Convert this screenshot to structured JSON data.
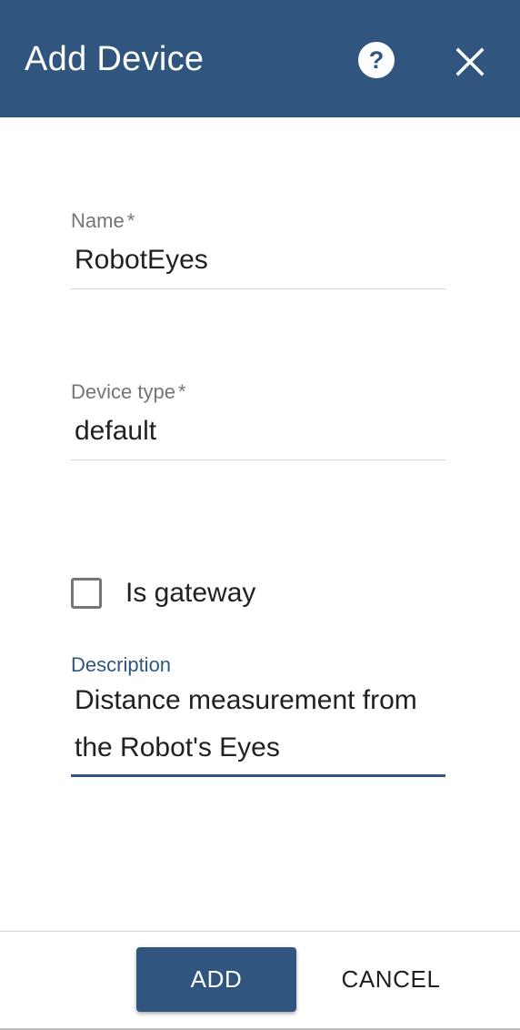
{
  "dialog": {
    "title": "Add Device",
    "help_icon": "help-circle-icon",
    "close_icon": "close-icon"
  },
  "form": {
    "name": {
      "label": "Name",
      "required_mark": "*",
      "value": "RobotEyes"
    },
    "device_type": {
      "label": "Device type",
      "required_mark": "*",
      "value": "default"
    },
    "is_gateway": {
      "label": "Is gateway",
      "checked": false
    },
    "description": {
      "label": "Description",
      "value": "Distance measurement from the Robot's Eyes"
    }
  },
  "actions": {
    "add_label": "ADD",
    "cancel_label": "CANCEL"
  },
  "colors": {
    "primary": "#305680",
    "label_gray": "#757575",
    "text": "#212121"
  }
}
